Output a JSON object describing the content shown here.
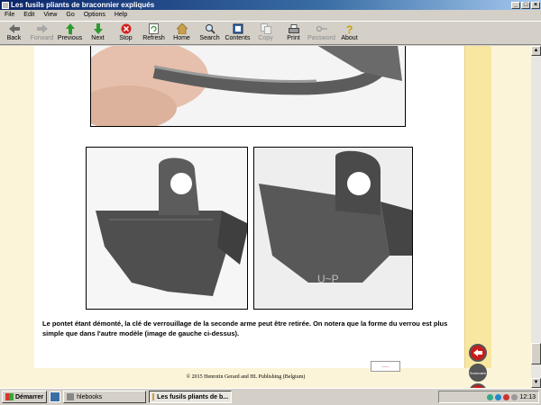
{
  "window": {
    "title": "Les fusils pliants de braconnier expliqués"
  },
  "menu": [
    "File",
    "Edit",
    "View",
    "Go",
    "Options",
    "Help"
  ],
  "toolbar": {
    "back": "Back",
    "forward": "Forward",
    "previous": "Previous",
    "next": "Next",
    "stop": "Stop",
    "refresh": "Refresh",
    "home": "Home",
    "search": "Search",
    "contents": "Contents",
    "copy": "Copy",
    "print": "Print",
    "password": "Password",
    "about": "About"
  },
  "page": {
    "caption": "Le pontet étant démonté, la clé de verrouillage de la seconde arme peut être retirée. On notera que la forme du verrou est plus simple que dans l'autre modèle (image de gauche ci-dessus).",
    "footer": "© 2015   Henrotin Gerard and HL Publishing (Belgium)",
    "nav_home_label": "Sommaire"
  },
  "taskbar": {
    "start": "Démarrer",
    "task1": "hlebooks",
    "task2": "Les fusils pliants de b...",
    "clock": "12:13"
  },
  "colors": {
    "accent": "#0a246a",
    "margin_band": "#f8e7a0",
    "nav_red": "#c91d1d"
  }
}
